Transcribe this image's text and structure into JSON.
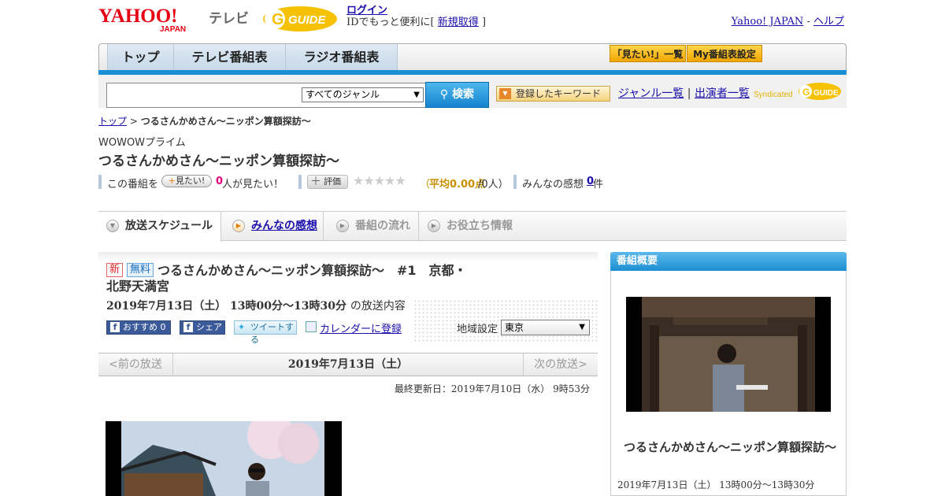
{
  "header": {
    "logo_text": "YAHOO!",
    "logo_sub": "JAPAN",
    "logo_tv": "テレビ",
    "gguide_text": "GUIDE",
    "login_label": "ログイン",
    "login_desc": "IDでもっと便利に[",
    "signup_label": "新規取得",
    "login_close": "]",
    "yahoo_japan_link": "Yahoo! JAPAN",
    "separator": "-",
    "help_link": "ヘルプ"
  },
  "nav": {
    "tabs": [
      {
        "label": "トップ"
      },
      {
        "label": "テレビ番組表"
      },
      {
        "label": "ラジオ番組表"
      }
    ],
    "mitai_list_button": "「見たい!」一覧",
    "my_settings_button": "My番組表設定"
  },
  "search": {
    "input_value": "",
    "genre_selected": "すべてのジャンル",
    "search_button": "検索",
    "keyword_button": "登録したキーワード",
    "genre_list_link": "ジャンル一覧",
    "divider": "|",
    "cast_list_link": "出演者一覧",
    "syndicated_text": "Syndicated",
    "syndicated_logo": "GUIDE"
  },
  "breadcrumb": {
    "home": "トップ",
    "sep": ">",
    "current": "つるさんかめさん～ニッポン算額探訪～"
  },
  "program": {
    "channel": "WOWOWプライム",
    "title": "つるさんかめさん～ニッポン算額探訪～"
  },
  "info_bar": {
    "prefix": "この番組を",
    "mitai_button": "見たい!",
    "mitai_count": "0",
    "mitai_suffix": "人が見たい！",
    "hyoka_button": "評価",
    "stars": "★★★★★",
    "rating_open": "（",
    "rating_label": "平均0.00点",
    "rating_count": "/0人）",
    "kanso_label": "みんなの感想",
    "kanso_count": "0",
    "kanso_unit": "件"
  },
  "section_tabs": [
    {
      "label": "放送スケジュール",
      "active": true
    },
    {
      "label": "みんなの感想",
      "active": false
    },
    {
      "label": "番組の流れ",
      "active": false
    },
    {
      "label": "お役立ち情報",
      "active": false
    }
  ],
  "episode": {
    "badge_new": "新",
    "badge_free": "無料",
    "title": "つるさんかめさん～ニッポン算額探訪～　#1　京都・北野天満宮",
    "date_time": "2019年7月13日（土）  13時00分～13時30分",
    "date_suffix": "の放送内容",
    "recommend_label": "おすすめ",
    "recommend_count": "0",
    "share_label": "シェア",
    "tweet_label": "ツイートする",
    "calendar_label": "カレンダーに登録",
    "region_label": "地域設定",
    "region_value": "東京"
  },
  "date_nav": {
    "prev": "<前の放送",
    "current": "2019年7月13日（土）",
    "next": "次の放送>"
  },
  "last_updated": "最終更新日：2019年7月10日（水）  9時53分",
  "sidebar": {
    "heading": "番組概要",
    "title": "つるさんかめさん～ニッポン算額探訪～",
    "date_time": "2019年7月13日（土）  13時00分～13時30分"
  },
  "colors": {
    "accent_blue": "#1b8fd6",
    "link": "#1a0dab",
    "new_badge": "#dd2222",
    "free_badge": "#1a6dbb",
    "gold_button": "#f0a500",
    "facebook": "#3b5a9a"
  }
}
